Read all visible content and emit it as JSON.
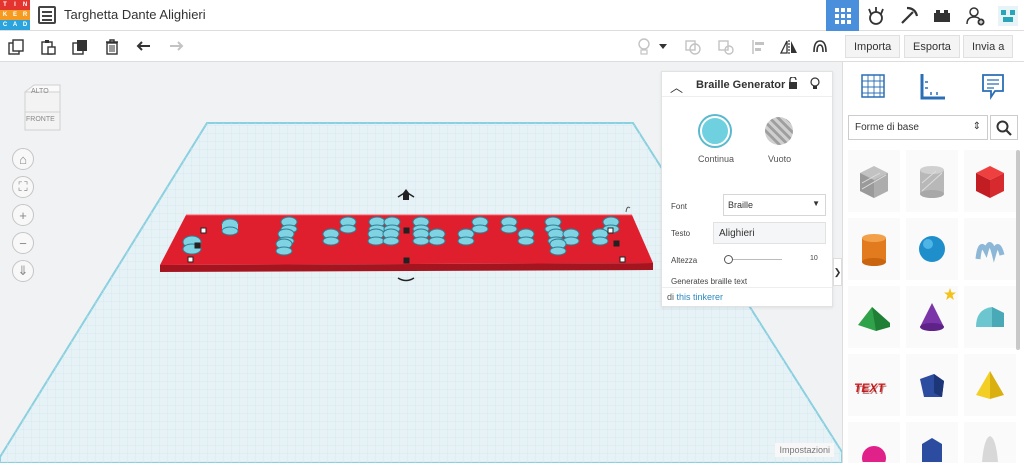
{
  "app": {
    "logo_letters": [
      "TIN",
      "KER",
      "CAD"
    ],
    "title": "Targhetta Dante Alighieri"
  },
  "top_nav": {
    "icons": [
      "grid-view-icon",
      "playground-icon",
      "blocks-pickaxe-icon",
      "bricks-icon",
      "user-add-icon",
      "profile-avatar-icon"
    ],
    "active": "grid-view-icon"
  },
  "toolbar": {
    "tools": [
      "copy-icon",
      "paste-icon",
      "duplicate-icon",
      "trash-icon",
      "undo-icon",
      "redo-icon"
    ],
    "right_tools": [
      "light-bulb-icon",
      "dropdown-icon",
      "group-icon",
      "ungroup-icon",
      "align-icon",
      "mirror-icon",
      "cruise-icon"
    ],
    "import_label": "Importa",
    "export_label": "Esporta",
    "send_label": "Invia a"
  },
  "viewcube": {
    "top_label": "ALTO",
    "front_label": "FRONTE"
  },
  "nav_controls": [
    "home-icon",
    "fit-icon",
    "zoom-in-icon",
    "zoom-out-icon",
    "ortho-icon"
  ],
  "shape_panel": {
    "title": "Braille Generator",
    "solid_label": "Continua",
    "hole_label": "Vuoto",
    "font_label": "Font",
    "font_value": "Braille",
    "text_label": "Testo",
    "text_value": "Alighieri",
    "height_label": "Altezza",
    "height_value": "10",
    "description": "Generates braille text",
    "author_prefix": "di",
    "author_link": "this tinkerer"
  },
  "settings_label": "Impostazioni",
  "sidebar": {
    "tabs": [
      "grid-tab-icon",
      "ruler-tab-icon",
      "notes-tab-icon"
    ],
    "category": "Forme di base",
    "shapes": [
      "box-hole",
      "cylinder-hole",
      "box",
      "cylinder",
      "sphere",
      "scribble",
      "roof",
      "cone",
      "round-roof",
      "text",
      "polygon",
      "pyramid",
      "half-sphere",
      "pentagon-prism",
      "paraboloid"
    ]
  },
  "colors": {
    "accent": "#4a8fdc",
    "plate_red": "#dd2233",
    "peg_cyan": "#6fd1e0",
    "grid_line": "#cfe6ee"
  }
}
